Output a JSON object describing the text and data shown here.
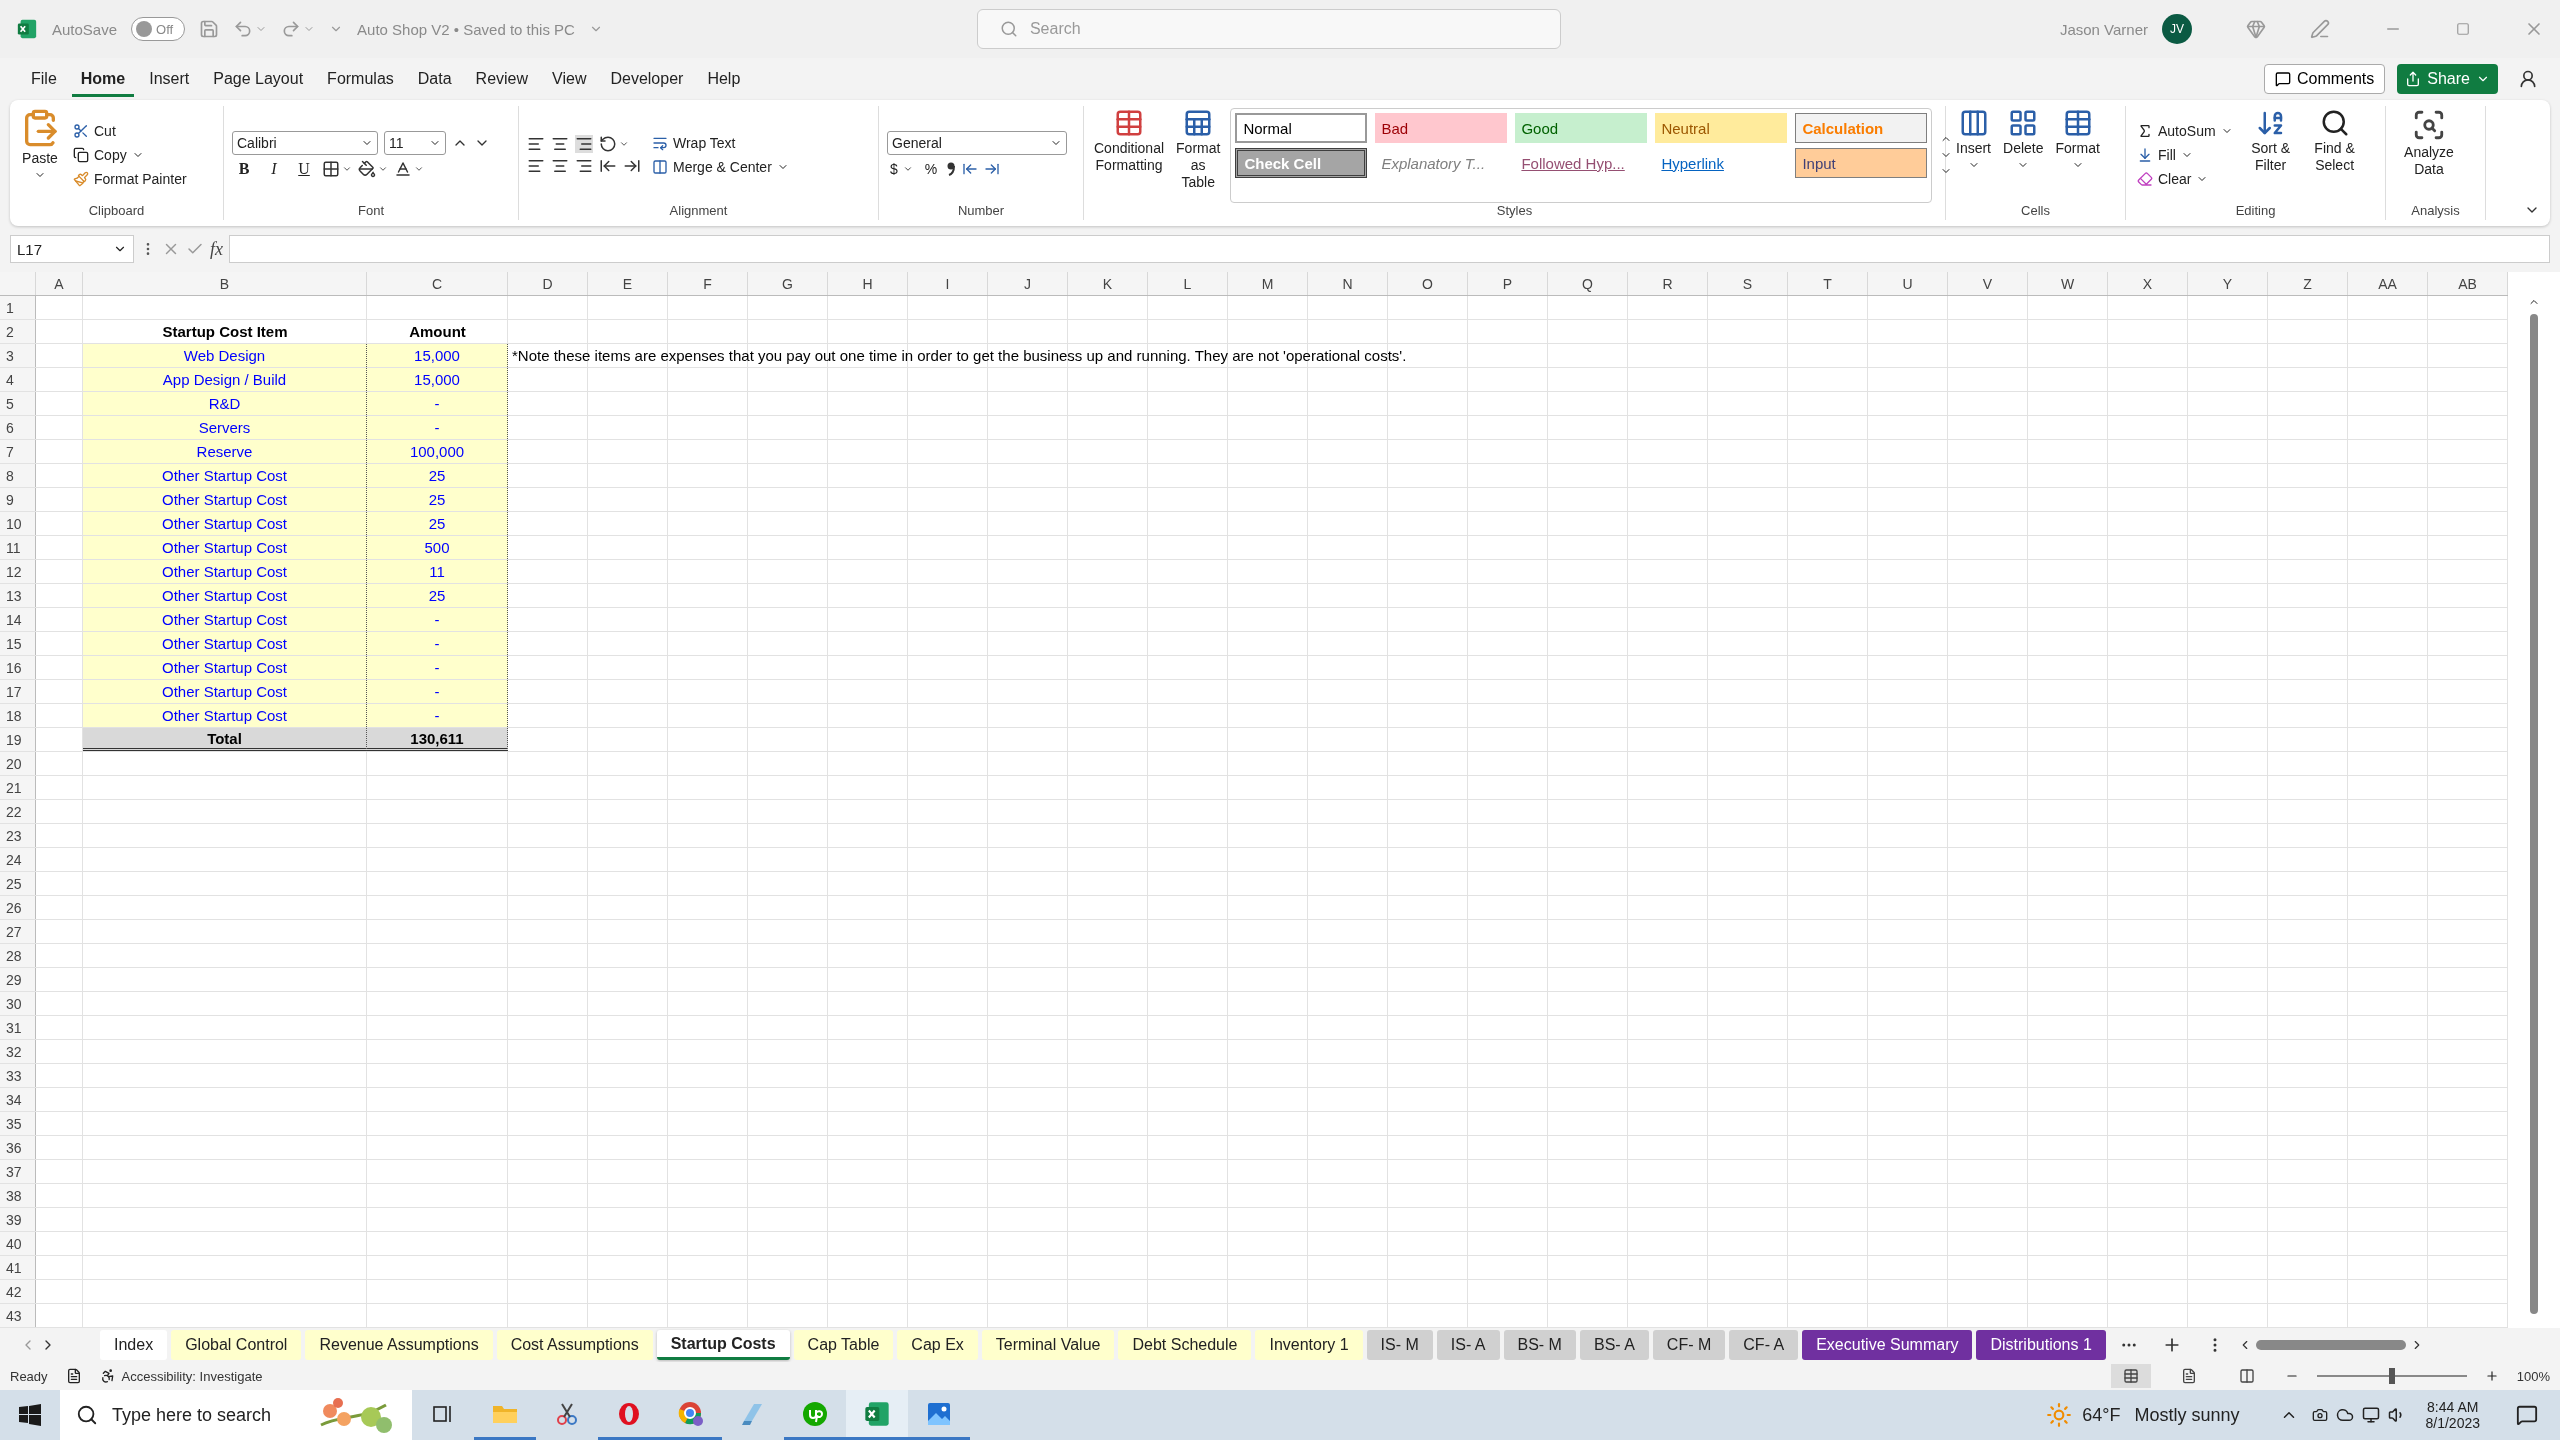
{
  "title_bar": {
    "autosave_label": "AutoSave",
    "autosave": {
      "on": false,
      "label": "Off"
    },
    "document": "Auto Shop V2 • Saved to this PC",
    "search": {
      "placeholder": "Search"
    },
    "user": "Jason Varner",
    "avatar": "JV"
  },
  "menu": [
    {
      "label": "File",
      "selected": false
    },
    {
      "label": "Home",
      "selected": true
    },
    {
      "label": "Insert",
      "selected": false
    },
    {
      "label": "Page Layout",
      "selected": false
    },
    {
      "label": "Formulas",
      "selected": false
    },
    {
      "label": "Data",
      "selected": false
    },
    {
      "label": "Review",
      "selected": false
    },
    {
      "label": "View",
      "selected": false
    },
    {
      "label": "Developer",
      "selected": false
    },
    {
      "label": "Help",
      "selected": false
    }
  ],
  "comments": "Comments",
  "share": "Share",
  "ribbon": {
    "clipboard": {
      "paste": "Paste",
      "cut": "Cut",
      "copy": "Copy",
      "format_painter": "Format Painter",
      "label": "Clipboard"
    },
    "font": {
      "name": "Calibri",
      "size": "11",
      "bold": "B",
      "italic": "I",
      "underline": "U",
      "label": "Font"
    },
    "alignment": {
      "wrap": "Wrap Text",
      "merge": "Merge & Center",
      "label": "Alignment"
    },
    "number": {
      "format": "General",
      "currency": "$",
      "percent": "%",
      "label": "Number"
    },
    "styles": {
      "conditional": "Conditional Formatting",
      "format_table": "Format as Table",
      "label": "Styles",
      "gallery": [
        {
          "label": "Normal",
          "kind": "normal"
        },
        {
          "label": "Bad",
          "kind": "bad"
        },
        {
          "label": "Good",
          "kind": "good"
        },
        {
          "label": "Neutral",
          "kind": "neutral"
        },
        {
          "label": "Calculation",
          "kind": "calculation"
        },
        {
          "label": "Check Cell",
          "kind": "check"
        },
        {
          "label": "Explanatory T...",
          "kind": "explanatory"
        },
        {
          "label": "Followed Hyp...",
          "kind": "followed"
        },
        {
          "label": "Hyperlink",
          "kind": "hyperlink"
        },
        {
          "label": "Input",
          "kind": "input"
        }
      ]
    },
    "cells": {
      "buttons": [
        "Insert",
        "Delete",
        "Format"
      ],
      "label": "Cells"
    },
    "editing": {
      "autosum": "AutoSum",
      "fill": "Fill",
      "clear": "Clear",
      "sort": "Sort & Filter",
      "find": "Find & Select",
      "label": "Editing"
    },
    "analysis": {
      "button": "Analyze Data",
      "label": "Analysis"
    }
  },
  "formula_bar": {
    "name_box": "L17",
    "fx": "fx"
  },
  "sheet": {
    "columns": [
      "A",
      "B",
      "C",
      "D",
      "E",
      "F",
      "G",
      "H",
      "I",
      "J",
      "K",
      "L",
      "M",
      "N",
      "O",
      "P",
      "Q",
      "R",
      "S",
      "T",
      "U",
      "V",
      "W",
      "X",
      "Y",
      "Z",
      "AA",
      "AB"
    ],
    "rows": [
      "1",
      "2",
      "3",
      "4",
      "5",
      "6",
      "7",
      "8",
      "9",
      "10",
      "11",
      "12",
      "13",
      "14",
      "15",
      "16",
      "17",
      "18",
      "19",
      "20",
      "21",
      "22",
      "23",
      "24",
      "25",
      "26",
      "27",
      "28",
      "29",
      "30",
      "31",
      "32",
      "33",
      "34",
      "35",
      "36",
      "37",
      "38",
      "39",
      "40",
      "41",
      "42",
      "43"
    ],
    "table": {
      "headers": [
        "Startup Cost Item",
        "Amount"
      ],
      "items": [
        {
          "item": "Web Design",
          "amount": "15,000"
        },
        {
          "item": "App Design / Build",
          "amount": "15,000"
        },
        {
          "item": "R&D",
          "amount": "-"
        },
        {
          "item": "Servers",
          "amount": "-"
        },
        {
          "item": "Reserve",
          "amount": "100,000"
        },
        {
          "item": "Other Startup Cost",
          "amount": "25"
        },
        {
          "item": "Other Startup Cost",
          "amount": "25"
        },
        {
          "item": "Other Startup Cost",
          "amount": "25"
        },
        {
          "item": "Other Startup Cost",
          "amount": "500"
        },
        {
          "item": "Other Startup Cost",
          "amount": "11"
        },
        {
          "item": "Other Startup Cost",
          "amount": "25"
        },
        {
          "item": "Other Startup Cost",
          "amount": "-"
        },
        {
          "item": "Other Startup Cost",
          "amount": "-"
        },
        {
          "item": "Other Startup Cost",
          "amount": "-"
        },
        {
          "item": "Other Startup Cost",
          "amount": "-"
        },
        {
          "item": "Other Startup Cost",
          "amount": "-"
        }
      ],
      "total": {
        "label": "Total",
        "amount": "130,611"
      }
    },
    "note": "*Note these items are expenses that you pay out one time in order to get the business up and running. They are not 'operational costs'."
  },
  "sheet_tabs": [
    {
      "label": "Index",
      "color": "#ffffff",
      "selected": false
    },
    {
      "label": "Global Control",
      "color": "#ffffcc",
      "selected": false
    },
    {
      "label": "Revenue Assumptions",
      "color": "#ffffcc",
      "selected": false
    },
    {
      "label": "Cost Assumptions",
      "color": "#ffffcc",
      "selected": false
    },
    {
      "label": "Startup Costs",
      "selected": true
    },
    {
      "label": "Cap Table",
      "color": "#ffffcc",
      "selected": false
    },
    {
      "label": "Cap Ex",
      "color": "#ffffcc",
      "selected": false
    },
    {
      "label": "Terminal Value",
      "color": "#ffffcc",
      "selected": false
    },
    {
      "label": "Debt Schedule",
      "color": "#ffffcc",
      "selected": false
    },
    {
      "label": "Inventory 1",
      "color": "#ffffcc",
      "selected": false
    },
    {
      "label": "IS- M",
      "color": "#d0d0d0",
      "selected": false
    },
    {
      "label": "IS- A",
      "color": "#d0d0d0",
      "selected": false
    },
    {
      "label": "BS- M",
      "color": "#d0d0d0",
      "selected": false
    },
    {
      "label": "BS- A",
      "color": "#d0d0d0",
      "selected": false
    },
    {
      "label": "CF- M",
      "color": "#d0d0d0",
      "selected": false
    },
    {
      "label": "CF- A",
      "color": "#d0d0d0",
      "selected": false
    },
    {
      "label": "Executive Summary",
      "color": "#7030a0",
      "selected": false
    },
    {
      "label": "Distributions 1",
      "color": "#7030a0",
      "selected": false
    }
  ],
  "status_bar": {
    "mode": "Ready",
    "accessibility": "Accessibility: Investigate",
    "views": [
      {
        "selected": true
      },
      {
        "selected": false
      },
      {
        "selected": false
      }
    ],
    "zoom": {
      "level": 0.5,
      "label": "100%"
    }
  },
  "taskbar": {
    "search": {
      "placeholder": "Type here to search"
    },
    "weather": {
      "temp": "64°F",
      "summary": "Mostly sunny"
    },
    "time": "8:44 AM",
    "date": "8/1/2023"
  }
}
